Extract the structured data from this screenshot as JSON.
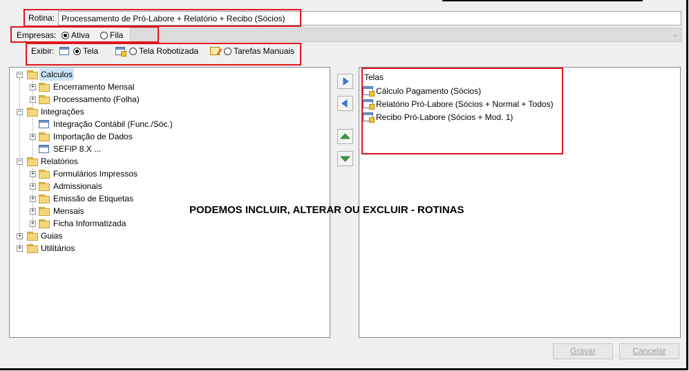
{
  "rotina": {
    "label": "Rotina:",
    "value": "Processamento de Pró-Labore + Relatório + Recibo (Sócios)"
  },
  "empresas": {
    "label": "Empresas:",
    "options": [
      {
        "label": "Ativa",
        "selected": true
      },
      {
        "label": "Fila",
        "selected": false
      }
    ]
  },
  "exibir": {
    "label": "Exibir:",
    "options": [
      {
        "label": "Tela",
        "icon": "screen-icon",
        "selected": true
      },
      {
        "label": "Tela Robotizada",
        "icon": "robot-screen-icon",
        "selected": false
      },
      {
        "label": "Tarefas Manuais",
        "icon": "manual-task-icon",
        "selected": false
      }
    ]
  },
  "tree": [
    {
      "label": "Calculos",
      "level": 0,
      "expander": "-",
      "icon": "folder-icon",
      "highlight": true
    },
    {
      "label": "Encerramento Mensal",
      "level": 1,
      "expander": "+",
      "icon": "folder-icon"
    },
    {
      "label": "Processamento (Folha)",
      "level": 1,
      "expander": "+",
      "icon": "folder-icon"
    },
    {
      "label": "Integrações",
      "level": 0,
      "expander": "-",
      "icon": "folder-icon"
    },
    {
      "label": "Integração Contábil (Func./Sóc.)",
      "level": 1,
      "expander": "",
      "icon": "screen-icon"
    },
    {
      "label": "Importação de Dados",
      "level": 1,
      "expander": "+",
      "icon": "folder-icon"
    },
    {
      "label": "SEFIP 8.X ...",
      "level": 1,
      "expander": "",
      "icon": "screen-icon"
    },
    {
      "label": "Relatórios",
      "level": 0,
      "expander": "-",
      "icon": "folder-icon"
    },
    {
      "label": "Formulários Impressos",
      "level": 1,
      "expander": "+",
      "icon": "folder-icon"
    },
    {
      "label": "Admissionais",
      "level": 1,
      "expander": "+",
      "icon": "folder-icon"
    },
    {
      "label": "Emissão de Etiquetas",
      "level": 1,
      "expander": "+",
      "icon": "folder-icon"
    },
    {
      "label": "Mensais",
      "level": 1,
      "expander": "+",
      "icon": "folder-icon"
    },
    {
      "label": "Ficha Informatizada",
      "level": 1,
      "expander": "+",
      "icon": "folder-icon"
    },
    {
      "label": "Guias",
      "level": 0,
      "expander": "+",
      "icon": "folder-icon"
    },
    {
      "label": "Utilitários",
      "level": 0,
      "expander": "+",
      "icon": "folder-icon"
    }
  ],
  "transfer": {
    "add_icon": "arrow-right-icon",
    "remove_icon": "arrow-left-icon",
    "up_icon": "arrow-up-icon",
    "down_icon": "arrow-down-icon"
  },
  "telas": {
    "title": "Telas",
    "items": [
      "Cálculo Pagamento (Sócios)",
      "Relatório Pró-Labore (Sócios + Normal + Todos)",
      "Recibo Pró-Labore (Sócios  + Mod. 1)"
    ]
  },
  "overlay_text": "PODEMOS INCLUIR, ALTERAR  OU EXCLUIR  - ROTINAS",
  "buttons": {
    "save": "Gravar",
    "cancel": "Cancelar"
  },
  "colors": {
    "highlight_red": "#e0141e",
    "arrow_blue": "#3d7fd9",
    "arrow_green": "#3a9a3a"
  }
}
